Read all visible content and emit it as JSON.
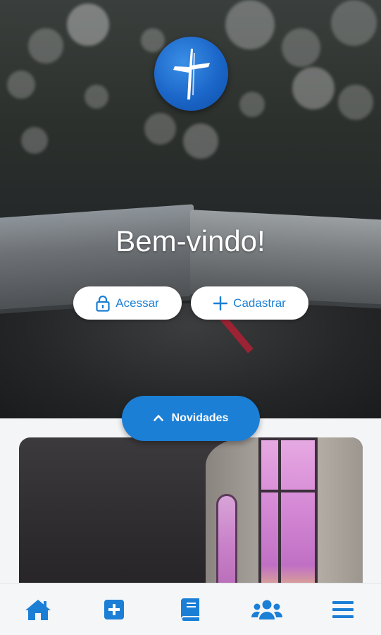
{
  "hero": {
    "welcome_text": "Bem-vindo!",
    "logo_icon": "cross-icon",
    "buttons": {
      "access_label": "Acessar",
      "access_icon": "lock-icon",
      "signup_label": "Cadastrar",
      "signup_icon": "plus-icon"
    }
  },
  "news": {
    "toggle_label": "Novidades",
    "toggle_icon": "chevron-up-icon"
  },
  "bottom_nav": {
    "items": [
      {
        "icon": "home-icon"
      },
      {
        "icon": "medical-plus-icon"
      },
      {
        "icon": "book-icon"
      },
      {
        "icon": "users-icon"
      },
      {
        "icon": "menu-icon"
      }
    ]
  },
  "colors": {
    "accent": "#1b7fd6",
    "logo_blue": "#1b66c9",
    "nav_background": "#f5f6f8",
    "button_text": "#1a7fd4"
  }
}
